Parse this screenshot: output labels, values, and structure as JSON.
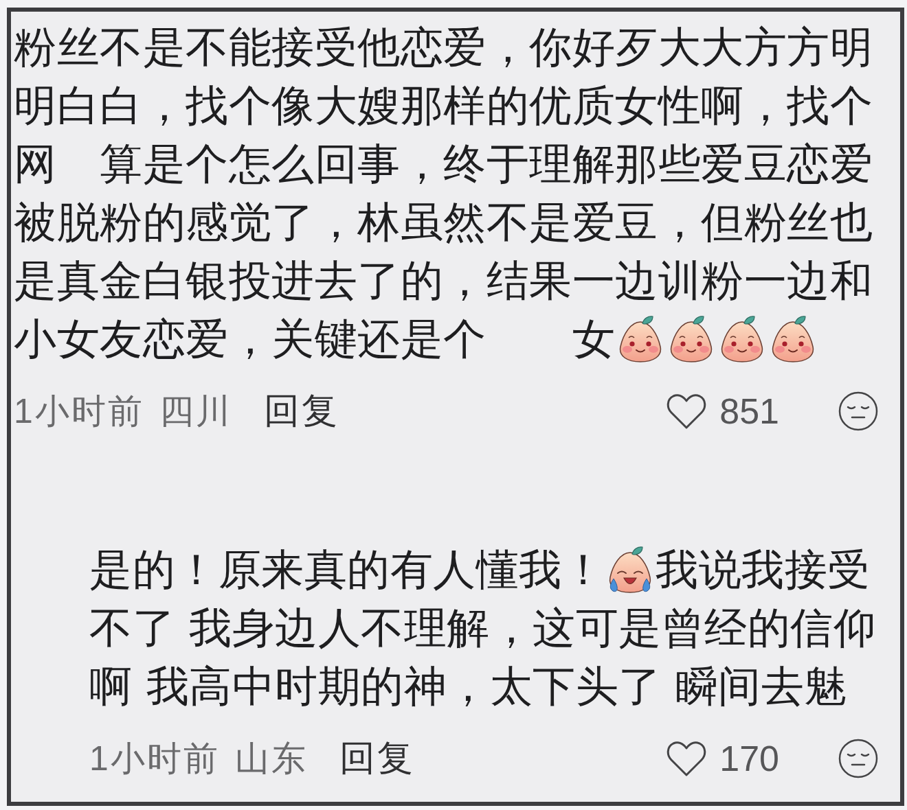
{
  "comments": [
    {
      "kind": "comment",
      "lines": [
        [
          {
            "kind": "text",
            "text": "粉丝不是不能接受他恋爱，你好歹大大方方明"
          }
        ],
        [
          {
            "kind": "text",
            "text": "明白白，找个像大嫂那样的优质女性啊，找个"
          }
        ],
        [
          {
            "kind": "text",
            "text": "网　算是个怎么回事，终于理解那些爱豆恋爱"
          }
        ],
        [
          {
            "kind": "text",
            "text": "被脱粉的感觉了，林虽然不是爱豆，但粉丝也"
          }
        ],
        [
          {
            "kind": "text",
            "text": "是真金白银投进去了的，结果一边训粉一边和"
          }
        ],
        [
          {
            "kind": "text",
            "text": "小女友恋爱，关键还是个　　女"
          },
          {
            "kind": "smile"
          },
          {
            "kind": "smile"
          },
          {
            "kind": "smile"
          },
          {
            "kind": "smile"
          }
        ]
      ],
      "time": "1小时前",
      "location": "四川",
      "reply": "回复",
      "likes": "851"
    },
    {
      "kind": "reply",
      "lines": [
        [
          {
            "kind": "text",
            "text": "是的！原来真的有人懂我！"
          },
          {
            "kind": "crying"
          },
          {
            "kind": "text",
            "text": "我说我接受"
          }
        ],
        [
          {
            "kind": "text",
            "text": "不了 我身边人不理解，这可是曾经的信仰"
          }
        ],
        [
          {
            "kind": "text",
            "text": "啊 我高中时期的神，太下头了 瞬间去魅"
          }
        ]
      ],
      "time": "1小时前",
      "location": "山东",
      "reply": "回复",
      "likes": "170"
    }
  ]
}
